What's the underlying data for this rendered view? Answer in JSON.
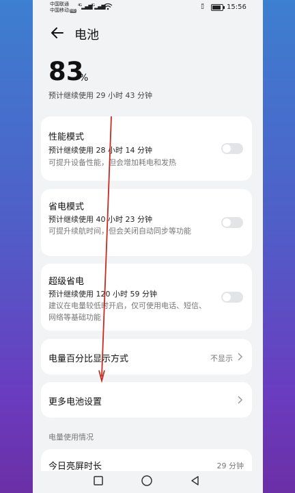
{
  "status_bar": {
    "carrier1": "中国联通",
    "carrier2": "中国移动",
    "hd_badge": "HD",
    "signal1_label": "4G",
    "signal2_label": "4G",
    "time": "15:56",
    "icons": [
      "signal-icon",
      "wifi-icon",
      "vibrate-icon",
      "battery-icon"
    ]
  },
  "header": {
    "title": "电池",
    "back_icon": "back-arrow-icon"
  },
  "battery": {
    "percent": "83",
    "percent_sign": "%",
    "level": 0.83,
    "remaining": "预计继续使用 29 小时 43 分钟"
  },
  "modes": [
    {
      "title": "性能模式",
      "estimate": "预计继续使用 28 小时 14 分钟",
      "desc": "可提升设备性能，但会增加耗电和发热",
      "enabled": false
    },
    {
      "title": "省电模式",
      "estimate": "预计继续使用 40 小时 23 分钟",
      "desc": "可提升续航时间，但会关闭自动同步等功能",
      "enabled": false
    },
    {
      "title": "超级省电",
      "estimate": "预计继续使用 120 小时 59 分钟",
      "desc": "建议在电量较低时开启，仅可使用电话、短信、网络等基础功能",
      "enabled": false
    }
  ],
  "percent_display": {
    "label": "电量百分比显示方式",
    "value": "不显示"
  },
  "more_settings": {
    "label": "更多电池设置"
  },
  "usage_section": {
    "label": "电量使用情况"
  },
  "screen_time": {
    "label": "今日亮屏时长",
    "value": "29 分钟"
  },
  "nav": {
    "back": "back-triangle-icon",
    "home": "home-circle-icon",
    "recents": "recents-square-icon"
  },
  "colors": {
    "annotation": "#c8281e",
    "card_bg": "#ffffff",
    "page_bg": "#f1f3f5",
    "toggle_off": "#e2e4e7"
  }
}
